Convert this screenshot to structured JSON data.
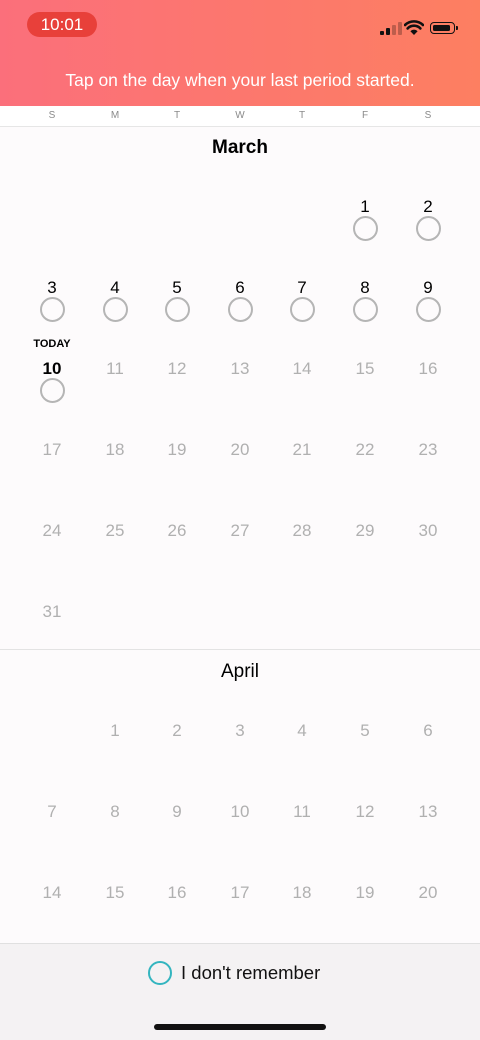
{
  "status_bar": {
    "time": "10:01"
  },
  "header": {
    "instruction": "Tap on the day when your last period started."
  },
  "weekdays": [
    "S",
    "M",
    "T",
    "W",
    "T",
    "F",
    "S"
  ],
  "months": [
    {
      "name": "March",
      "today_label": "TODAY",
      "rows": [
        [
          null,
          null,
          null,
          null,
          null,
          "1",
          "2"
        ],
        [
          "3",
          "4",
          "5",
          "6",
          "7",
          "8",
          "9"
        ],
        [
          "10",
          "11",
          "12",
          "13",
          "14",
          "15",
          "16"
        ],
        [
          "17",
          "18",
          "19",
          "20",
          "21",
          "22",
          "23"
        ],
        [
          "24",
          "25",
          "26",
          "27",
          "28",
          "29",
          "30"
        ],
        [
          "31",
          null,
          null,
          null,
          null,
          null,
          null
        ]
      ]
    },
    {
      "name": "April",
      "rows": [
        [
          null,
          "1",
          "2",
          "3",
          "4",
          "5",
          "6"
        ],
        [
          "7",
          "8",
          "9",
          "10",
          "11",
          "12",
          "13"
        ],
        [
          "14",
          "15",
          "16",
          "17",
          "18",
          "19",
          "20"
        ]
      ]
    }
  ],
  "footer": {
    "dont_remember_label": "I don't remember"
  },
  "colors": {
    "header_start": "#fb6f7b",
    "header_end": "#fd7f61",
    "accent_ring": "#33b5bf"
  }
}
